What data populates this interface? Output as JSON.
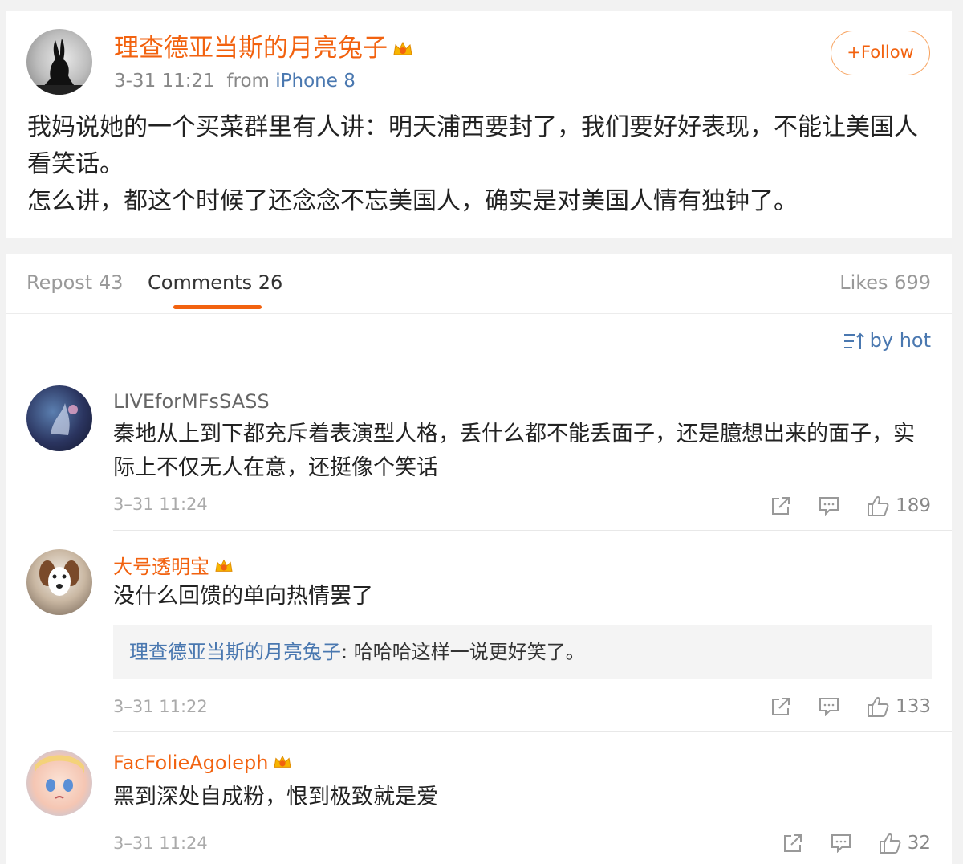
{
  "post": {
    "username": "理查德亚当斯的月亮兔子",
    "time": "3-31 11:21",
    "from_label": "from",
    "device": "iPhone 8",
    "follow_label": "+Follow",
    "text_lines": [
      "我妈说她的一个买菜群里有人讲：明天浦西要封了，我们要好好表现，不能让美国人看笑话。",
      "怎么讲，都这个时候了还念念不忘美国人，确实是对美国人情有独钟了。"
    ]
  },
  "tabs": {
    "repost": "Repost 43",
    "comments": "Comments 26",
    "likes": "Likes 699"
  },
  "sort": {
    "label": "by hot"
  },
  "comments": [
    {
      "username": "LIVEforMFsSASS",
      "text": "秦地从上到下都充斥着表演型人格，丢什么都不能丢面子，还是臆想出来的面子，实际上不仅无人在意，还挺像个笑话",
      "time": "3–31 11:24",
      "likes": "189"
    },
    {
      "username": "大号透明宝",
      "text": "没什么回馈的单向热情罢了",
      "reply": {
        "name": "理查德亚当斯的月亮兔子",
        "text": ": 哈哈哈这样一说更好笑了。"
      },
      "time": "3–31 11:22",
      "likes": "133"
    },
    {
      "username": "FacFolieAgoleph",
      "text": "黑到深处自成粉，恨到极致就是爱",
      "time": "3–31 11:24",
      "likes": "32"
    }
  ],
  "colors": {
    "accent": "#f2620f",
    "link": "#4a78b0",
    "muted": "#999999"
  }
}
